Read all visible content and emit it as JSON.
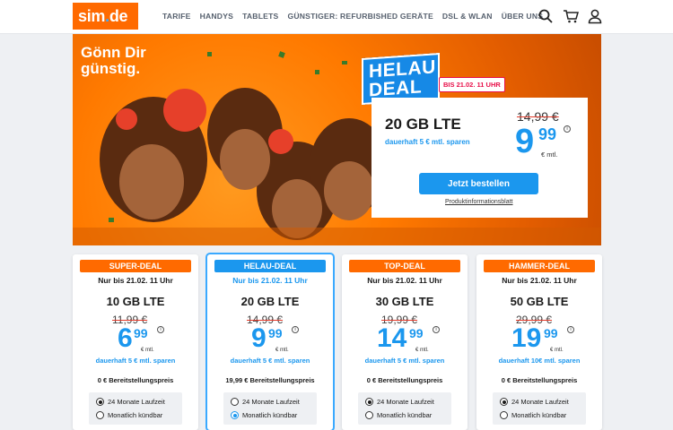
{
  "header": {
    "logo": {
      "main": "sim",
      "dot": ".",
      "tld": "de"
    },
    "nav": [
      "TARIFE",
      "HANDYS",
      "TABLETS",
      "GÜNSTIGER: REFURBISHED GERÄTE",
      "DSL & WLAN",
      "ÜBER UNS"
    ],
    "icons": [
      "search-icon",
      "cart-icon",
      "user-icon"
    ]
  },
  "hero": {
    "headline_line1": "Gönn Dir",
    "headline_line2": "günstig.",
    "badge_line1": "HELAU",
    "badge_line2": "DEAL",
    "date_tag": "BIS 21.02. 11 UHR",
    "offer": {
      "volume": "20 GB LTE",
      "saving": "dauerhaft 5 € mtl. sparen",
      "old_price": "14,99 €",
      "price_main": "9",
      "price_cents": "99",
      "per_month": "€ mtl.",
      "cta": "Jetzt bestellen",
      "info_link": "Produktinformationsblatt"
    }
  },
  "cards": [
    {
      "tag": "SUPER-DEAL",
      "until": "Nur bis 21.02. 11 Uhr",
      "volume": "10 GB LTE",
      "old_price": "11,99 €",
      "price_main": "6",
      "price_cents": "99",
      "per_month": "€ mtl.",
      "saving": "dauerhaft 5 € mtl. sparen",
      "setup": "0 € Bereitstellungspreis",
      "opt1": "24 Monate Laufzeit",
      "opt2": "Monatlich kündbar"
    },
    {
      "tag": "HELAU-DEAL",
      "until": "Nur bis 21.02. 11 Uhr",
      "volume": "20 GB LTE",
      "old_price": "14,99 €",
      "price_main": "9",
      "price_cents": "99",
      "per_month": "€ mtl.",
      "saving": "dauerhaft 5 € mtl. sparen",
      "setup": "19,99 € Bereitstellungspreis",
      "opt1": "24 Monate Laufzeit",
      "opt2": "Monatlich kündbar"
    },
    {
      "tag": "TOP-DEAL",
      "until": "Nur bis 21.02. 11 Uhr",
      "volume": "30 GB LTE",
      "old_price": "19,99 €",
      "price_main": "14",
      "price_cents": "99",
      "per_month": "€ mtl.",
      "saving": "dauerhaft 5 € mtl. sparen",
      "setup": "0 € Bereitstellungspreis",
      "opt1": "24 Monate Laufzeit",
      "opt2": "Monatlich kündbar"
    },
    {
      "tag": "HAMMER-DEAL",
      "until": "Nur bis 21.02. 11 Uhr",
      "volume": "50 GB LTE",
      "old_price": "29,99 €",
      "price_main": "19",
      "price_cents": "99",
      "per_month": "€ mtl.",
      "saving": "dauerhaft 10€ mtl. sparen",
      "setup": "0 € Bereitstellungspreis",
      "opt1": "24 Monate Laufzeit",
      "opt2": "Monatlich kündbar"
    }
  ],
  "info_symbol": "i",
  "colors": {
    "brand_orange": "#ff6a00",
    "brand_blue": "#1b97ee",
    "strike_red": "#e23b2b",
    "deal_pink": "#e8104a"
  }
}
